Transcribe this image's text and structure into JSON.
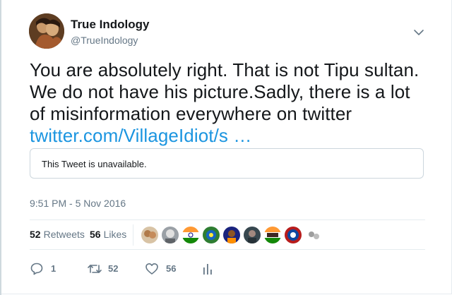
{
  "tweet": {
    "author_name": "True Indology",
    "author_handle": "@TrueIndology",
    "text": "You are absolutely right. That is not Tipu sultan. We do not have his picture.Sadly, there is a lot of misinformation everywhere on twitter ",
    "link_text": "twitter.com/VillageIdiot/s …",
    "quote_unavailable_text": "This Tweet is unavailable.",
    "timestamp": "9:51 PM - 5 Nov 2016"
  },
  "stats": {
    "retweets_count": "52",
    "retweets_label": "Retweets",
    "likes_count": "56",
    "likes_label": "Likes"
  },
  "actions": {
    "reply_count": "1",
    "retweet_count": "52",
    "like_count": "56"
  },
  "colors": {
    "link": "#1b95e0",
    "secondary_text": "#657786",
    "border": "#e6ecf0",
    "icon": "#657786"
  },
  "icons": {
    "caret": "chevron-down-icon",
    "reply": "reply-icon",
    "retweet": "retweet-icon",
    "like": "heart-icon",
    "analytics": "analytics-icon"
  }
}
